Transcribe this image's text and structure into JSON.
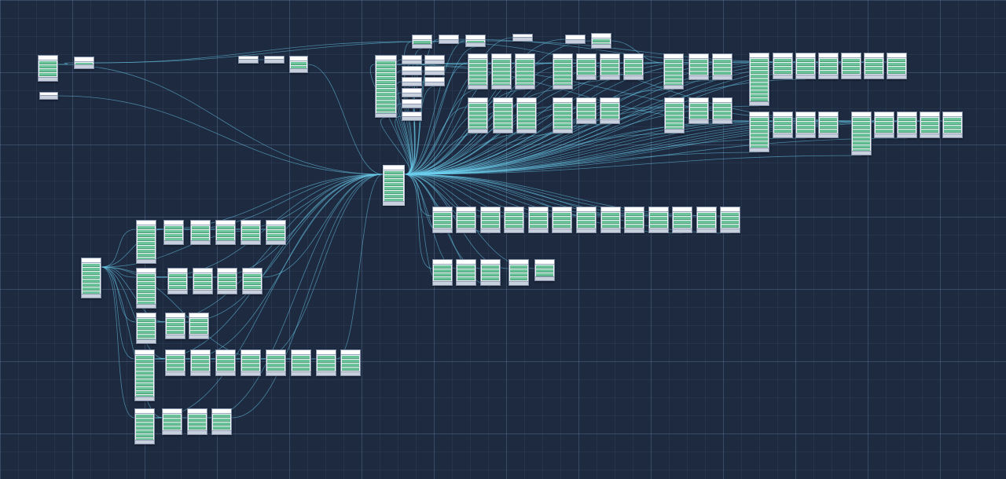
{
  "diagram": {
    "kind": "node-graph",
    "colors": {
      "background": "#1d2a40",
      "edge": "#6ed0ee",
      "node_body": "#eef1f6",
      "field_row": "#6cc49a",
      "node_footer": "#c9d0dd"
    },
    "hub_node_id": "hub"
  }
}
